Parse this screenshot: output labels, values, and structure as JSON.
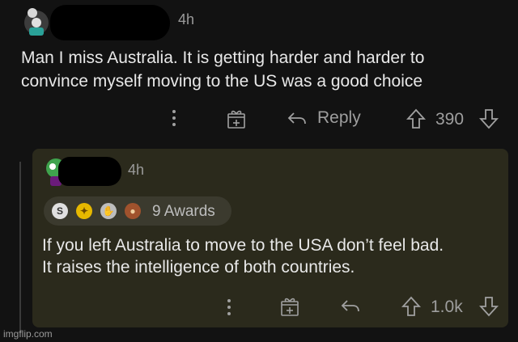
{
  "comment": {
    "time": "4h",
    "text_line1": "Man I miss Australia.  It is getting harder and harder to",
    "text_line2": "convince myself moving to the US was a good choice",
    "reply_label": "Reply",
    "score": "390"
  },
  "reply": {
    "time": "4h",
    "awards_label": "9 Awards",
    "text_line1": "If you left Australia to move to the USA don’t feel bad.",
    "text_line2": "It raises the intelligence of both countries.",
    "score": "1.0k"
  },
  "watermark": "imgflip.com",
  "colors": {
    "background": "#121212",
    "card": "#2b2a1c",
    "text": "#e8e8e8",
    "muted": "#9e9e9e"
  }
}
